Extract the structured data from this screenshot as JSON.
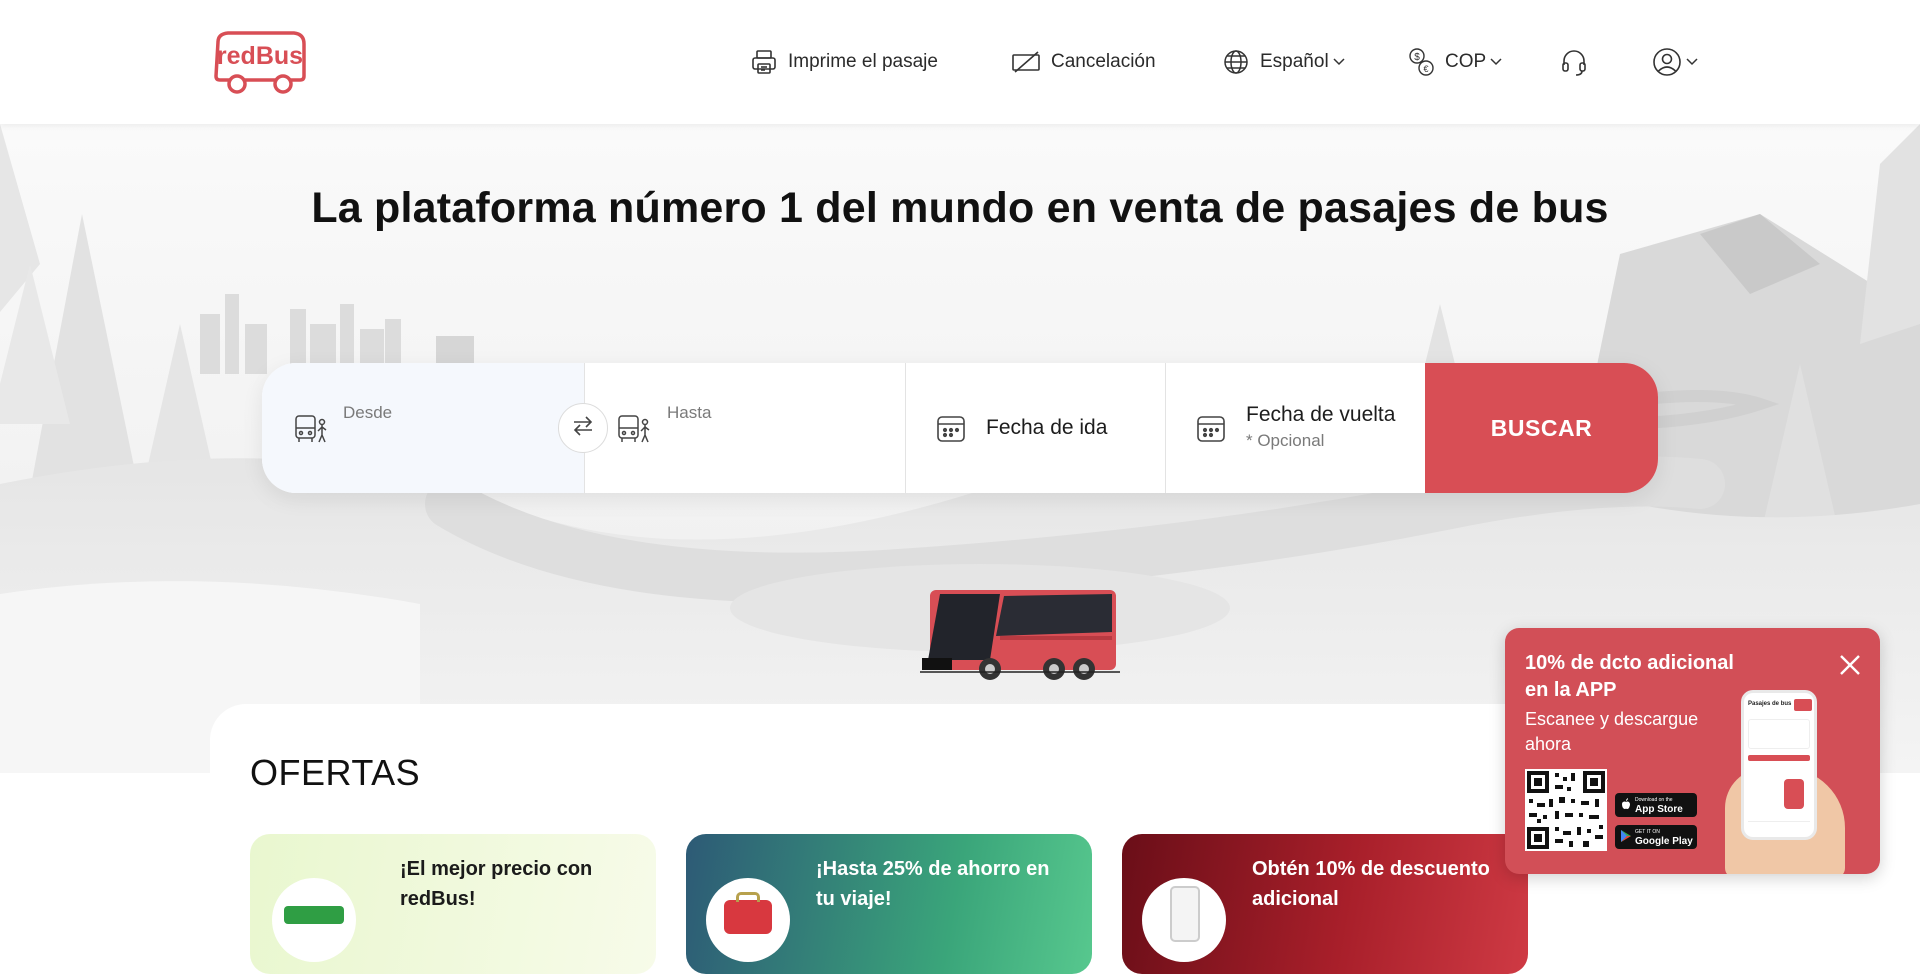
{
  "header": {
    "logo_text": "redBus",
    "nav": {
      "print": "Imprime el pasaje",
      "cancel": "Cancelación",
      "language": "Español",
      "currency": "COP"
    }
  },
  "hero": {
    "title": "La plataforma número 1 del mundo en venta de pasajes de bus"
  },
  "search": {
    "from_placeholder": "Desde",
    "to_placeholder": "Hasta",
    "date_label": "Fecha de ida",
    "return_label": "Fecha de vuelta",
    "return_optional": "* Opcional",
    "button": "BUSCAR"
  },
  "offers": {
    "title": "OFERTAS",
    "cards": [
      {
        "text": "¡El mejor precio con redBus!"
      },
      {
        "text": "¡Hasta 25% de ahorro en tu viaje!"
      },
      {
        "text": "Obtén 10% de descuento adicional"
      }
    ]
  },
  "promo": {
    "title": "10% de dcto adicional en la APP",
    "subtitle": "Escanee y descargue ahora",
    "app_store_small": "Download on the",
    "app_store": "App Store",
    "google_small": "GET IT ON",
    "google": "Google Play",
    "phone_title": "Pasajes de bus"
  },
  "colors": {
    "brand": "#d84e55",
    "promo_bg": "#d24f57"
  }
}
